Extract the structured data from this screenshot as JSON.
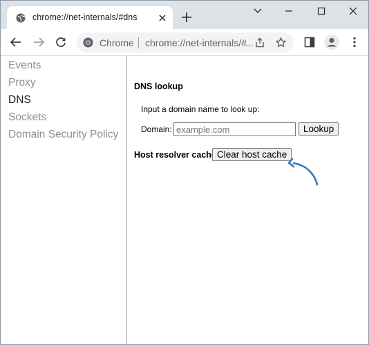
{
  "tab": {
    "title": "chrome://net-internals/#dns"
  },
  "omnibox": {
    "origin_label": "Chrome",
    "url": "chrome://net-internals/#dns"
  },
  "sidebar": {
    "items": [
      {
        "label": "Events",
        "active": false
      },
      {
        "label": "Proxy",
        "active": false
      },
      {
        "label": "DNS",
        "active": true
      },
      {
        "label": "Sockets",
        "active": false
      },
      {
        "label": "Domain Security Policy",
        "active": false
      }
    ]
  },
  "dns_lookup": {
    "heading": "DNS lookup",
    "prompt": "Input a domain name to look up:",
    "domain_label": "Domain:",
    "domain_value": "",
    "domain_placeholder": "example.com",
    "lookup_button": "Lookup"
  },
  "host_cache": {
    "heading": "Host resolver cache",
    "clear_button": "Clear host cache"
  },
  "colors": {
    "annotation_arrow": "#3a78b8",
    "tab_strip": "#dee1e6"
  },
  "icons": [
    "globe-icon",
    "close-icon",
    "plus-icon",
    "chevron-down-icon",
    "minimize-icon",
    "maximize-icon",
    "window-close-icon",
    "back-arrow-icon",
    "forward-arrow-icon",
    "reload-icon",
    "chrome-icon",
    "share-icon",
    "star-icon",
    "side-panel-icon",
    "profile-icon",
    "kebab-menu-icon"
  ]
}
